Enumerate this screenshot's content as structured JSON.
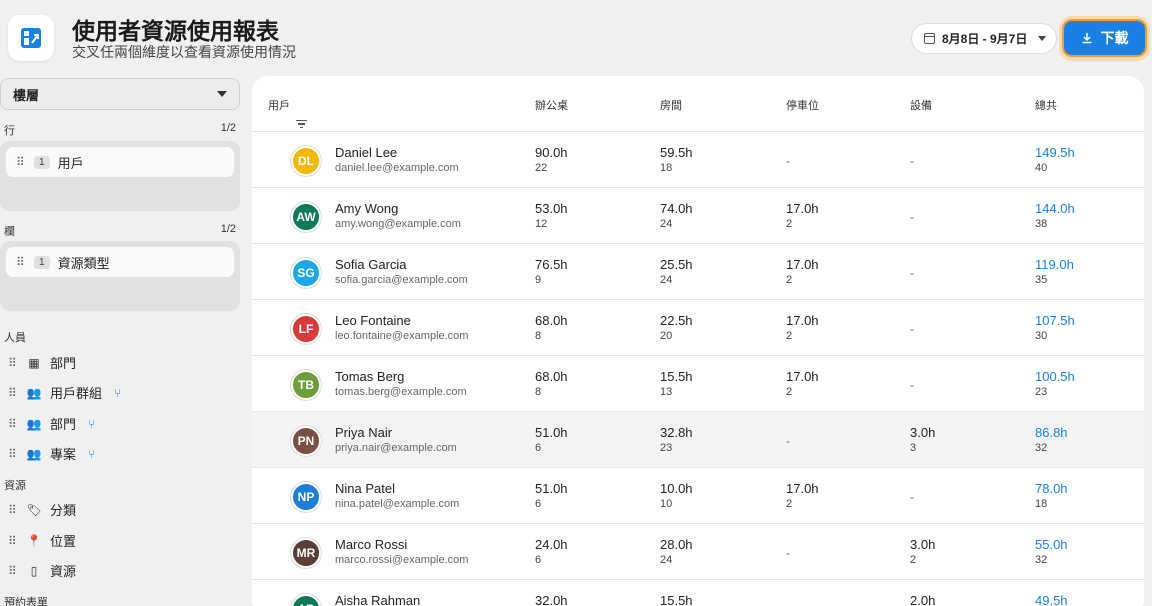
{
  "header": {
    "title": "使用者資源使用報表",
    "subtitle": "交叉任兩個維度以查看資源使用情況",
    "date_range": "8月8日 - 9月7日",
    "download_label": "下載"
  },
  "sidebar": {
    "floor_select": "樓層",
    "rows_label": "行",
    "rows_count": "1/2",
    "rows_chip": {
      "num": "1",
      "label": "用戶"
    },
    "cols_label": "欄",
    "cols_count": "1/2",
    "cols_chip": {
      "num": "1",
      "label": "資源類型"
    },
    "groups": [
      {
        "label": "人員",
        "items": [
          {
            "label": "部門",
            "icon": "building-icon"
          },
          {
            "label": "用戶群組",
            "icon": "people-icon",
            "branch": true
          },
          {
            "label": "部門",
            "icon": "people-icon",
            "branch": true
          },
          {
            "label": "專案",
            "icon": "people-icon",
            "branch": true
          }
        ]
      },
      {
        "label": "資源",
        "items": [
          {
            "label": "分類",
            "icon": "tag-icon"
          },
          {
            "label": "位置",
            "icon": "pin-icon"
          },
          {
            "label": "資源",
            "icon": "phone-icon"
          }
        ]
      },
      {
        "label": "預約表單",
        "items": []
      }
    ]
  },
  "table": {
    "headers": {
      "user": "用戶",
      "desk": "辦公桌",
      "room": "房間",
      "parking": "停車位",
      "equipment": "設備",
      "total": "總共"
    },
    "rows": [
      {
        "initials": "DL",
        "color": "#f5b800",
        "name": "Daniel Lee",
        "email": "daniel.lee@example.com",
        "desk": [
          "90.0h",
          "22"
        ],
        "room": [
          "59.5h",
          "18"
        ],
        "parking": "-",
        "equipment": "-",
        "total": [
          "149.5h",
          "40"
        ]
      },
      {
        "initials": "AW",
        "color": "#0e7a5a",
        "name": "Amy Wong",
        "email": "amy.wong@example.com",
        "desk": [
          "53.0h",
          "12"
        ],
        "room": [
          "74.0h",
          "24"
        ],
        "parking": [
          "17.0h",
          "2"
        ],
        "equipment": "-",
        "total": [
          "144.0h",
          "38"
        ]
      },
      {
        "initials": "SG",
        "color": "#1aa9e8",
        "name": "Sofia Garcia",
        "email": "sofia.garcia@example.com",
        "desk": [
          "76.5h",
          "9"
        ],
        "room": [
          "25.5h",
          "24"
        ],
        "parking": [
          "17.0h",
          "2"
        ],
        "equipment": "-",
        "total": [
          "119.0h",
          "35"
        ]
      },
      {
        "initials": "LF",
        "color": "#d63a3a",
        "name": "Leo Fontaine",
        "email": "leo.fontaine@example.com",
        "desk": [
          "68.0h",
          "8"
        ],
        "room": [
          "22.5h",
          "20"
        ],
        "parking": [
          "17.0h",
          "2"
        ],
        "equipment": "-",
        "total": [
          "107.5h",
          "30"
        ]
      },
      {
        "initials": "TB",
        "color": "#6e9e3a",
        "name": "Tomas Berg",
        "email": "tomas.berg@example.com",
        "desk": [
          "68.0h",
          "8"
        ],
        "room": [
          "15.5h",
          "13"
        ],
        "parking": [
          "17.0h",
          "2"
        ],
        "equipment": "-",
        "total": [
          "100.5h",
          "23"
        ]
      },
      {
        "initials": "PN",
        "color": "#7a5044",
        "name": "Priya Nair",
        "email": "priya.nair@example.com",
        "desk": [
          "51.0h",
          "6"
        ],
        "room": [
          "32.8h",
          "23"
        ],
        "parking": "-",
        "equipment": [
          "3.0h",
          "3"
        ],
        "total": [
          "86.8h",
          "32"
        ]
      },
      {
        "initials": "NP",
        "color": "#1a7fd6",
        "name": "Nina Patel",
        "email": "nina.patel@example.com",
        "desk": [
          "51.0h",
          "6"
        ],
        "room": [
          "10.0h",
          "10"
        ],
        "parking": [
          "17.0h",
          "2"
        ],
        "equipment": "-",
        "total": [
          "78.0h",
          "18"
        ]
      },
      {
        "initials": "MR",
        "color": "#5a3d33",
        "name": "Marco Rossi",
        "email": "marco.rossi@example.com",
        "desk": [
          "24.0h",
          "6"
        ],
        "room": [
          "28.0h",
          "24"
        ],
        "parking": "-",
        "equipment": [
          "3.0h",
          "2"
        ],
        "total": [
          "55.0h",
          "32"
        ]
      },
      {
        "initials": "AR",
        "color": "#0e7a5a",
        "name": "Aisha Rahman",
        "email": "",
        "desk": [
          "32.0h",
          ""
        ],
        "room": [
          "15.5h",
          ""
        ],
        "parking": "",
        "equipment": [
          "2.0h",
          ""
        ],
        "total": [
          "49.5h",
          ""
        ]
      }
    ]
  }
}
